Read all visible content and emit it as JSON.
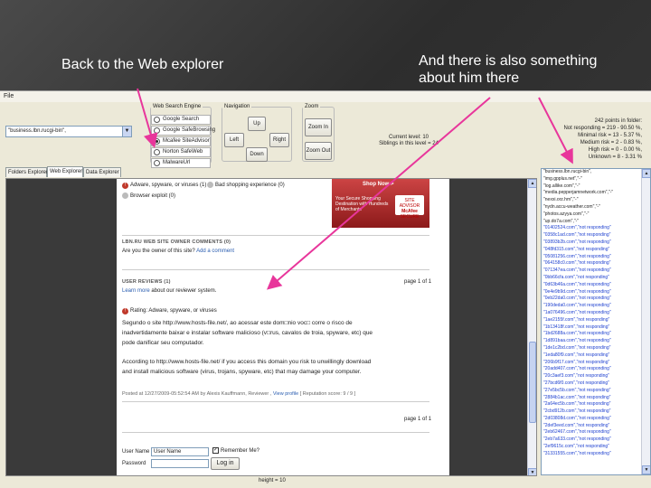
{
  "callouts": {
    "left": "Back to the Web explorer",
    "right": "And there is also something about him there"
  },
  "menu": {
    "file": "File"
  },
  "url_combo": {
    "value": "\"business.lbn.rucgi-bin\","
  },
  "search_engine": {
    "legend": "Web Search Engine",
    "options": [
      "Google Search",
      "Google SafeBrowsing",
      "Mcafee SiteAdvisor",
      "Norton SafeWeb",
      "MalwareUrl"
    ],
    "selected_index": 2
  },
  "navigation": {
    "legend": "Navigation",
    "up": "Up",
    "left": "Left",
    "right": "Right",
    "down": "Down"
  },
  "zoom": {
    "legend": "Zoom",
    "zoom_in": "Zoom In",
    "zoom_out": "Zoom Out"
  },
  "level_info": {
    "current": "Current level: 10",
    "siblings": "Siblings in this level = 24"
  },
  "stats": {
    "lines": [
      "242 points in folder:",
      "Not responding = 219 - 90.50 %,",
      "Minimal risk = 13 - 5.37 %,",
      "Medium risk = 2 - 0.83 %,",
      "High risk = 0 - 0.00 %,",
      "Unknown = 8 - 3.31 %"
    ]
  },
  "tabs": [
    "Folders Explorer",
    "Web Explorer",
    "Data Explorer"
  ],
  "page": {
    "ad": {
      "shop": "Shop Now >",
      "copy": "Your Secure Shopping Destination with Hundreds of Merchants",
      "logo_top": "SITE ADVISOR",
      "logo_brand": "McAfee",
      "logo_sub": "SECURE"
    },
    "adware_line": "Adware, spyware, or viruses (1)",
    "bad_shopping": "Bad shopping experience (0)",
    "browser_exploit": "Browser exploit (0)",
    "owner_heading": "LBN.RU WEB SITE OWNER COMMENTS (0)",
    "owner_question": "Are you the owner of this site?",
    "owner_link": "Add a comment",
    "reviews_heading": "USER REVIEWS (1)",
    "page_of": "page 1 of 1",
    "learn_more_link": "Learn more",
    "learn_more_rest": "about our reviewer system.",
    "rating": "Rating: Adware, spyware, or viruses",
    "review_pt": [
      "Segundo o site http://www.hosts-file.net/, ao acessar este dom□nio voc□ corre o risco de",
      "inadvertidamente baixar e instalar software malicioso (v□rus, cavalos de troia, spyware, etc) que",
      "pode danificar seu computador."
    ],
    "review_en": [
      "According to http://www.hosts-file.net/ if you access this domain you risk to unwillingly download",
      "and install malicious software (virus, trojans, spyware, etc) that may damage your computer."
    ],
    "posted_prefix": "Posted at 12/27/2009-05:52:54 AM by Alexis Kauffmann, Reviewer ,",
    "view_profile": "View profile",
    "reputation": "[ Reputation score: 9 / 9 ]",
    "page_of_bottom": "page 1 of 1",
    "login": {
      "username_label": "User Name",
      "username_value": "User Name",
      "remember": "Remember Me?",
      "password_label": "Password",
      "login_button": "Log in"
    }
  },
  "list_items": [
    {
      "text": "\"business.lbn.rucgi-bin\",",
      "blue": false
    },
    {
      "text": "\"img.gpplus.net\",\"-\"",
      "blue": false
    },
    {
      "text": "\"log.allike.com\",\"-\"",
      "blue": false
    },
    {
      "text": "\"media.pepperjamnetwork.com\",\"-\"",
      "blue": false
    },
    {
      "text": "\"nexxi.orz.hm\",\"-\"",
      "blue": false
    },
    {
      "text": "\"nydn.accu-weather.com\",\"-\"",
      "blue": false
    },
    {
      "text": "\"photos.azyya.com\",\"-\"",
      "blue": false
    },
    {
      "text": "\"up.do7a.com\",\"-\"",
      "blue": false
    },
    {
      "text": "\"01402524.com\",\"not responding\"",
      "blue": true
    },
    {
      "text": "\"0358c1ad.com\",\"not responding\"",
      "blue": true
    },
    {
      "text": "\"03893b2b.com\",\"not responding\"",
      "blue": true
    },
    {
      "text": "\"048fd315.com\",\"not responding\"",
      "blue": true
    },
    {
      "text": "\"05081256.com\",\"not responding\"",
      "blue": true
    },
    {
      "text": "\"064158c0.com\",\"not responding\"",
      "blue": true
    },
    {
      "text": "\"071347ea.com\",\"not responding\"",
      "blue": true
    },
    {
      "text": "\"0bb66cfa.com\",\"not responding\"",
      "blue": true
    },
    {
      "text": "\"0d63b46a.com\",\"not responding\"",
      "blue": true
    },
    {
      "text": "\"0e4e9b9d.com\",\"not responding\"",
      "blue": true
    },
    {
      "text": "\"0eb22da0.com\",\"not responding\"",
      "blue": true
    },
    {
      "text": "\"190deda0.com\",\"not responding\"",
      "blue": true
    },
    {
      "text": "\"1a076496.com\",\"not responding\"",
      "blue": true
    },
    {
      "text": "\"1ae2155f.com\",\"not responding\"",
      "blue": true
    },
    {
      "text": "\"1b13418f.com\",\"not responding\"",
      "blue": true
    },
    {
      "text": "\"1bd2688a.com\",\"not responding\"",
      "blue": true
    },
    {
      "text": "\"1d891baa.com\",\"not responding\"",
      "blue": true
    },
    {
      "text": "\"1de1c2bd.com\",\"not responding\"",
      "blue": true
    },
    {
      "text": "\"1eda80f9.com\",\"not responding\"",
      "blue": true
    },
    {
      "text": "\"206b9f17.com\",\"not responding\"",
      "blue": true
    },
    {
      "text": "\"20add407.com\",\"not responding\"",
      "blue": true
    },
    {
      "text": "\"20c3aef3.com\",\"not responding\"",
      "blue": true
    },
    {
      "text": "\"27bcd6f0.com\",\"not responding\"",
      "blue": true
    },
    {
      "text": "\"27e5bc5b.com\",\"not responding\"",
      "blue": true
    },
    {
      "text": "\"2884b1ac.com\",\"not responding\"",
      "blue": true
    },
    {
      "text": "\"2a64ec5b.com\",\"not responding\"",
      "blue": true
    },
    {
      "text": "\"2cbd912b.com\",\"not responding\"",
      "blue": true
    },
    {
      "text": "\"2d03808d.com\",\"not responding\"",
      "blue": true
    },
    {
      "text": "\"2def3eed.com\",\"not responding\"",
      "blue": true
    },
    {
      "text": "\"2eb62467.com\",\"not responding\"",
      "blue": true
    },
    {
      "text": "\"2eb7a633.com\",\"not responding\"",
      "blue": true
    },
    {
      "text": "\"2ef9615c.com\",\"not responding\"",
      "blue": true
    },
    {
      "text": "\"31331555.com\",\"not responding\"",
      "blue": true
    }
  ],
  "height_label": "height = 10",
  "accent_color": "#e8369b"
}
